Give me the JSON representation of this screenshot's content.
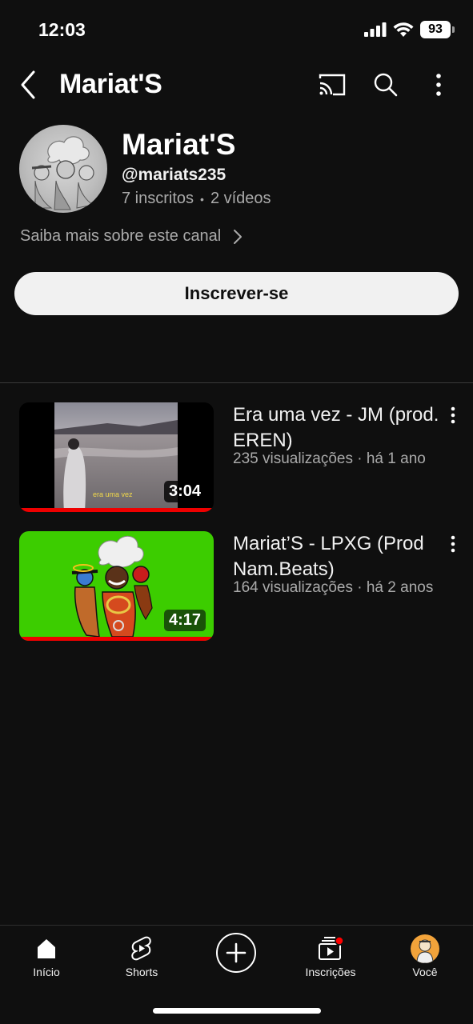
{
  "status_bar": {
    "time": "12:03",
    "battery": "93"
  },
  "header": {
    "title": "Mariat'S"
  },
  "channel": {
    "name": "Mariat'S",
    "handle": "@mariats235",
    "subscribers": "7 inscritos",
    "videos_count": "2 vídeos",
    "about_link": "Saiba mais sobre este canal",
    "subscribe_label": "Inscrever-se"
  },
  "videos": [
    {
      "title": "Era uma vez - JM (prod. EREN)",
      "meta": "235 visualizações · há 1 ano",
      "duration": "3:04",
      "thumb_caption": "era uma vez"
    },
    {
      "title": "Mariat’S - LPXG (Prod Nam.Beats)",
      "meta": "164 visualizações · há 2 anos",
      "duration": "4:17"
    }
  ],
  "nav": {
    "items": [
      {
        "label": "Início",
        "icon": "home-icon"
      },
      {
        "label": "Shorts",
        "icon": "shorts-icon"
      },
      {
        "label": "",
        "icon": "create-icon"
      },
      {
        "label": "Inscrições",
        "icon": "subscriptions-icon"
      },
      {
        "label": "Você",
        "icon": "avatar"
      }
    ]
  },
  "colors": {
    "background": "#0f0f0f",
    "accent_red": "#ff0000",
    "thumb_green": "#3ccd00"
  }
}
